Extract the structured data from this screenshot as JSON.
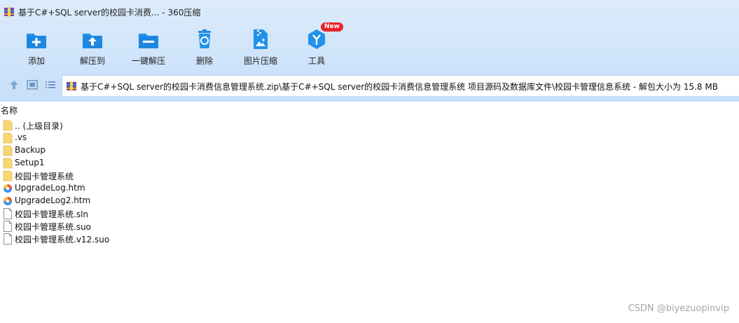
{
  "window": {
    "title": "基于C#+SQL server的校园卡消费... - 360压缩"
  },
  "toolbar": [
    {
      "label": "添加",
      "icon": "add-folder-icon"
    },
    {
      "label": "解压到",
      "icon": "extract-to-icon"
    },
    {
      "label": "一键解压",
      "icon": "one-click-extract-icon"
    },
    {
      "label": "删除",
      "icon": "delete-icon"
    },
    {
      "label": "图片压缩",
      "icon": "image-compress-icon"
    },
    {
      "label": "工具",
      "icon": "tools-icon",
      "badge": "New"
    }
  ],
  "address": {
    "path": "基于C#+SQL server的校园卡消费信息管理系统.zip\\基于C#+SQL server的校园卡消费信息管理系统 项目源码及数据库文件\\校园卡管理信息系统 - 解包大小为 15.8 MB"
  },
  "columns": {
    "name": "名称"
  },
  "files": [
    {
      "name": ".. (上级目录)",
      "type": "folder"
    },
    {
      "name": ".vs",
      "type": "folder"
    },
    {
      "name": "Backup",
      "type": "folder"
    },
    {
      "name": "Setup1",
      "type": "folder"
    },
    {
      "name": "校园卡管理系统",
      "type": "folder"
    },
    {
      "name": "UpgradeLog.htm",
      "type": "htm"
    },
    {
      "name": "UpgradeLog2.htm",
      "type": "htm"
    },
    {
      "name": "校园卡管理系统.sln",
      "type": "file"
    },
    {
      "name": "校园卡管理系统.suo",
      "type": "file"
    },
    {
      "name": "校园卡管理系统.v12.suo",
      "type": "file"
    }
  ],
  "watermark": "CSDN @biyezuopinvip",
  "colors": {
    "accent": "#1e90e8",
    "toolbar_bg": "#d2e6fb"
  }
}
